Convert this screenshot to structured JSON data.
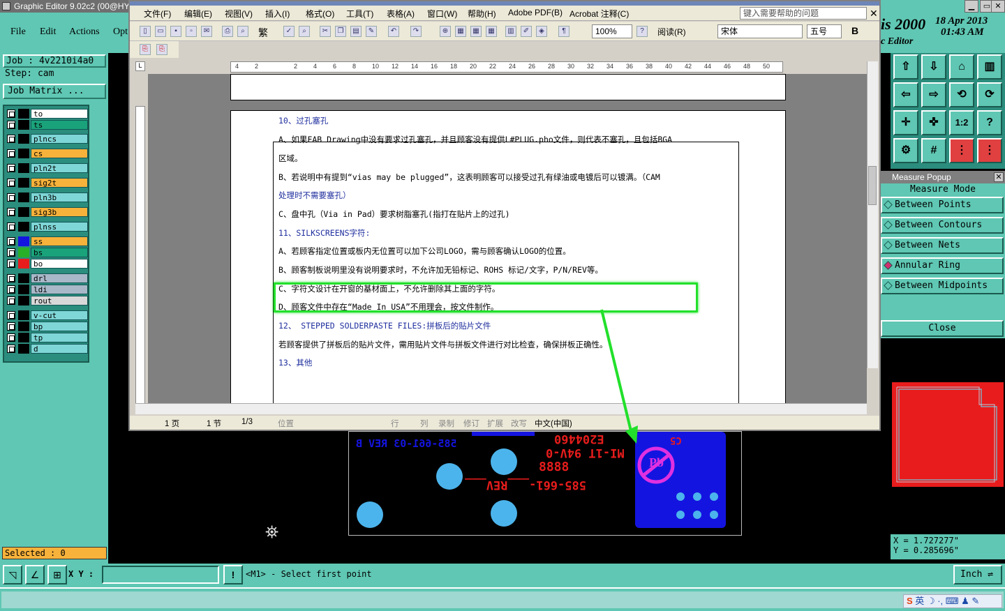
{
  "genesis": {
    "title": "Graphic Editor 9.02c2 (00@HY",
    "menu": [
      "File",
      "Edit",
      "Actions",
      "Opt"
    ],
    "job": "Job : 4v2210i4a0",
    "step": "Step: cam",
    "job_matrix": "Job Matrix ...",
    "layers": [
      {
        "name": "to",
        "color": "#ffffff",
        "sw": "#000000"
      },
      {
        "name": "ts",
        "color": "#1aa37a",
        "sw": "#000000"
      },
      {
        "name": "plncs",
        "color": "#7fd6d6",
        "sw": "#000000"
      },
      {
        "name": "cs",
        "color": "#f7b23b",
        "sw": "#000000"
      },
      {
        "name": "pln2t",
        "color": "#7fd6d6",
        "sw": "#000000"
      },
      {
        "name": "sig2t",
        "color": "#f7b23b",
        "sw": "#000000"
      },
      {
        "name": "pln3b",
        "color": "#7fd6d6",
        "sw": "#000000"
      },
      {
        "name": "sig3b",
        "color": "#f7b23b",
        "sw": "#000000"
      },
      {
        "name": "plnss",
        "color": "#7fd6d6",
        "sw": "#000000"
      },
      {
        "name": "ss",
        "color": "#f7b23b",
        "sw": "#1414e0"
      },
      {
        "name": "bs",
        "color": "#1aa37a",
        "sw": "#28b028"
      },
      {
        "name": "bo",
        "color": "#ffffff",
        "sw": "#e81c1c"
      },
      {
        "name": "drl",
        "color": "#a8b8c8",
        "sw": "#000000"
      },
      {
        "name": "ldi",
        "color": "#a8b8c8",
        "sw": "#000000"
      },
      {
        "name": "rout",
        "color": "#d8d8d8",
        "sw": "#000000"
      },
      {
        "name": "v-cut",
        "color": "#7fd6d6",
        "sw": "#000000"
      },
      {
        "name": "bp",
        "color": "#7fd6d6",
        "sw": "#000000"
      },
      {
        "name": "tp",
        "color": "#7fd6d6",
        "sw": "#000000"
      },
      {
        "name": "d",
        "color": "#7fd6d6",
        "sw": "#000000"
      }
    ],
    "selected": "Selected : 0",
    "brand": "is 2000",
    "brand_sub": "c Editor",
    "date": "18 Apr 2013",
    "time": "01:43 AM",
    "measure": {
      "title": "Measure Popup",
      "mode": "Measure Mode",
      "options": [
        "Between Points",
        "Between Contours",
        "Between Nets",
        "Annular Ring",
        "Between Midpoints"
      ],
      "close": "Close"
    },
    "x_coord": "X = 1.727277\"",
    "y_coord": "Y = 0.285696\"",
    "xy_label": "X Y :",
    "prompt": "<M1> - Select first point",
    "unit": "Inch",
    "tray_lang": "英"
  },
  "word": {
    "menu": [
      "文件(F)",
      "编辑(E)",
      "视图(V)",
      "插入(I)",
      "格式(O)",
      "工具(T)",
      "表格(A)",
      "窗口(W)",
      "帮助(H)",
      "Adobe PDF(B)",
      "Acrobat 注释(C)"
    ],
    "help_placeholder": "键入需要帮助的问题",
    "zoom": "100%",
    "read": "阅读(R)",
    "font": "宋体",
    "size": "五号",
    "bold": "B",
    "trad": "繁",
    "ruler": [
      "4",
      "2",
      "",
      "2",
      "4",
      "6",
      "8",
      "10",
      "12",
      "14",
      "16",
      "18",
      "20",
      "22",
      "24",
      "26",
      "28",
      "30",
      "32",
      "34",
      "36",
      "38",
      "40",
      "42",
      "44",
      "46",
      "48",
      "50"
    ],
    "lines": [
      {
        "t": "10、过孔塞孔",
        "c": "blue"
      },
      {
        "t": "A、如果FAB Drawing中没有要求过孔塞孔，并且顾客没有提供L#PLUG.pho文件，则代表不塞孔，且包括BGA",
        "c": ""
      },
      {
        "t": "区域。",
        "c": ""
      },
      {
        "t": "B、若说明中有提到“vias may be plugged”，这表明顾客可以接受过孔有绿油或电镀后可以镀满。（CAM",
        "c": ""
      },
      {
        "t": "处理时不需要塞孔）",
        "c": "blue"
      },
      {
        "t": "C、盘中孔（Via in Pad）要求树脂塞孔(指打在贴片上的过孔)",
        "c": ""
      },
      {
        "t": "11、SILKSCREENS字符:",
        "c": "blue"
      },
      {
        "t": "A、若顾客指定位置或板内无位置可以加下公司LOGO，需与顾客确认LOGO的位置。",
        "c": ""
      },
      {
        "t": "B、顾客制板说明里没有说明要求时，不允许加无铅标记、ROHS 标记/文字，P/N/REV等。",
        "c": ""
      },
      {
        "t": "C、字符文设计在开窗的基材面上，不允许删除其上面的字符。",
        "c": ""
      },
      {
        "t": "D、顾客文件中存在“Made In USA”不用理会，按文件制作。",
        "c": ""
      },
      {
        "t": "12、 STEPPED SOLDERPASTE FILES:拼板后的贴片文件",
        "c": "blue"
      },
      {
        "t": "若顾客提供了拼板后的贴片文件，需用贴片文件与拼板文件进行对比检查，确保拼板正确性。",
        "c": ""
      },
      {
        "t": "13、其他",
        "c": "blue"
      }
    ],
    "status": {
      "page": "1 页",
      "section": "1 节",
      "pages": "1/3",
      "pos": "位置",
      "row": "行",
      "col": "列",
      "rec": "录制",
      "rev": "修订",
      "ext": "扩展",
      "ovr": "改写",
      "lang": "中文(中国)"
    }
  },
  "pcb": {
    "text1": "585-661-03 REV B",
    "text2": "E204460",
    "text3": "MI-1T 94V-0",
    "text4": "8888",
    "text5": "585-661-___REV___",
    "text6": "C5",
    "text7": "Pb"
  }
}
